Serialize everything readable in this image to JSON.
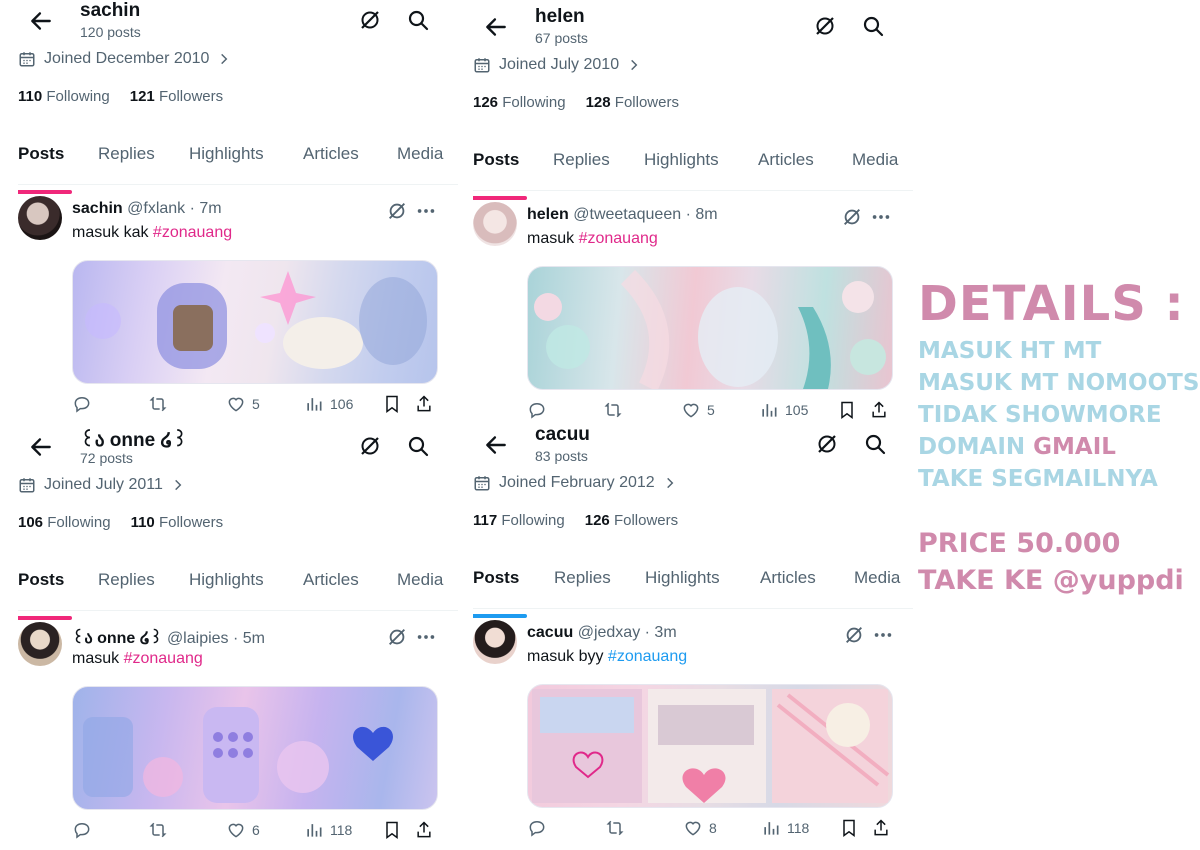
{
  "panels": [
    {
      "name": "sachin",
      "post_count": "120 posts",
      "joined": "Joined December 2010",
      "following_num": "110",
      "following_label": "Following",
      "followers_num": "121",
      "followers_label": "Followers",
      "tabs": [
        "Posts",
        "Replies",
        "Highlights",
        "Articles",
        "Media"
      ],
      "tab_accent": "#f0287a",
      "post": {
        "display_name": "sachin",
        "meta": "@fxlank · 7m",
        "text": "masuk kak",
        "hashtag": "#zonauang",
        "hashtag_color": "#e0298a",
        "likes": "5",
        "views": "106"
      }
    },
    {
      "name": "helen",
      "post_count": "67 posts",
      "joined": "Joined July 2010",
      "following_num": "126",
      "following_label": "Following",
      "followers_num": "128",
      "followers_label": "Followers",
      "tabs": [
        "Posts",
        "Replies",
        "Highlights",
        "Articles",
        "Media"
      ],
      "tab_accent": "#f0287a",
      "post": {
        "display_name": "helen",
        "meta": "@tweetaqueen · 8m",
        "text": "masuk",
        "hashtag": "#zonauang",
        "hashtag_color": "#e0298a",
        "likes": "5",
        "views": "105"
      }
    },
    {
      "name": "꒰ა onne ໒꒱",
      "post_count": "72 posts",
      "joined": "Joined July 2011",
      "following_num": "106",
      "following_label": "Following",
      "followers_num": "110",
      "followers_label": "Followers",
      "tabs": [
        "Posts",
        "Replies",
        "Highlights",
        "Articles",
        "Media"
      ],
      "tab_accent": "#f0287a",
      "post": {
        "display_name": "꒰ა onne ໒꒱",
        "meta": "@laipies · 5m",
        "text": "masuk",
        "hashtag": "#zonauang",
        "hashtag_color": "#e0298a",
        "likes": "6",
        "views": "118"
      }
    },
    {
      "name": "cacuu",
      "post_count": "83 posts",
      "joined": "Joined February 2012",
      "following_num": "117",
      "following_label": "Following",
      "followers_num": "126",
      "followers_label": "Followers",
      "tabs": [
        "Posts",
        "Replies",
        "Highlights",
        "Articles",
        "Media"
      ],
      "tab_accent": "#1d9bf0",
      "post": {
        "display_name": "cacuu",
        "meta": "@jedxay · 3m",
        "text": "masuk byy",
        "hashtag": "#zonauang",
        "hashtag_color": "#1d9bf0",
        "likes": "8",
        "views": "118"
      }
    }
  ],
  "details": {
    "title": "DETAILS :",
    "line1": "MASUK HT MT",
    "line2": "MASUK MT NOMOOTS",
    "line3": "TIDAK SHOWMORE",
    "line4_a": "DOMAIN",
    "line4_b": "GMAIL",
    "line5": "TAKE SEGMAILNYA",
    "price": "PRICE 50.000",
    "take": "TAKE KE @yuppdi"
  },
  "icons": {
    "back": "arrow-left-icon",
    "grok": "grok-icon",
    "search": "search-icon",
    "calendar": "calendar-icon",
    "chevron": "chevron-right-icon",
    "more": "more-icon",
    "reply": "reply-icon",
    "retweet": "retweet-icon",
    "like": "heart-icon",
    "views": "views-icon",
    "bookmark": "bookmark-icon",
    "share": "share-icon"
  },
  "colors": {
    "pink_accent": "#f0287a",
    "blue_accent": "#1d9bf0",
    "details_pink": "#d08aac",
    "details_blue": "#a9d6e4"
  }
}
